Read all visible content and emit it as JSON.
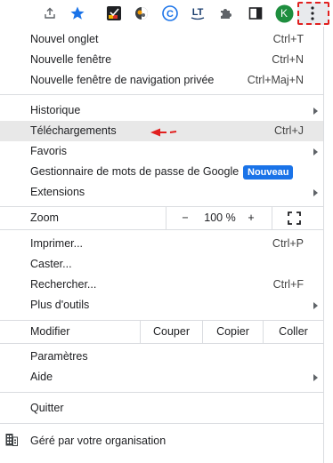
{
  "toolbar": {
    "icons": [
      "share-icon",
      "bookmark-star-icon",
      "extension-icon-1",
      "extension-icon-2",
      "extension-icon-3",
      "languagetool-icon",
      "extensions-puzzle-icon",
      "side-panel-icon",
      "profile-avatar",
      "chrome-menu-icon"
    ],
    "profile_initial": "K",
    "languagetool_text": "LT",
    "colors": {
      "star": "#1a73e8",
      "avatar": "#1e8e3e",
      "annotation": "#e1201f"
    }
  },
  "menu": {
    "new_tab": {
      "label": "Nouvel onglet",
      "shortcut": "Ctrl+T"
    },
    "new_window": {
      "label": "Nouvelle fenêtre",
      "shortcut": "Ctrl+N"
    },
    "new_incognito": {
      "label": "Nouvelle fenêtre de navigation privée",
      "shortcut": "Ctrl+Maj+N"
    },
    "history": {
      "label": "Historique"
    },
    "downloads": {
      "label": "Téléchargements",
      "shortcut": "Ctrl+J"
    },
    "bookmarks": {
      "label": "Favoris"
    },
    "password_manager": {
      "label": "Gestionnaire de mots de passe de Google",
      "badge": "Nouveau"
    },
    "extensions": {
      "label": "Extensions"
    },
    "zoom": {
      "label": "Zoom",
      "minus": "−",
      "value": "100 %",
      "plus": "+"
    },
    "print": {
      "label": "Imprimer...",
      "shortcut": "Ctrl+P"
    },
    "cast": {
      "label": "Caster..."
    },
    "find": {
      "label": "Rechercher...",
      "shortcut": "Ctrl+F"
    },
    "more_tools": {
      "label": "Plus d'outils"
    },
    "edit": {
      "label": "Modifier",
      "cut": "Couper",
      "copy": "Copier",
      "paste": "Coller"
    },
    "settings": {
      "label": "Paramètres"
    },
    "help": {
      "label": "Aide"
    },
    "exit": {
      "label": "Quitter"
    },
    "managed": {
      "label": "Géré par votre organisation"
    }
  }
}
